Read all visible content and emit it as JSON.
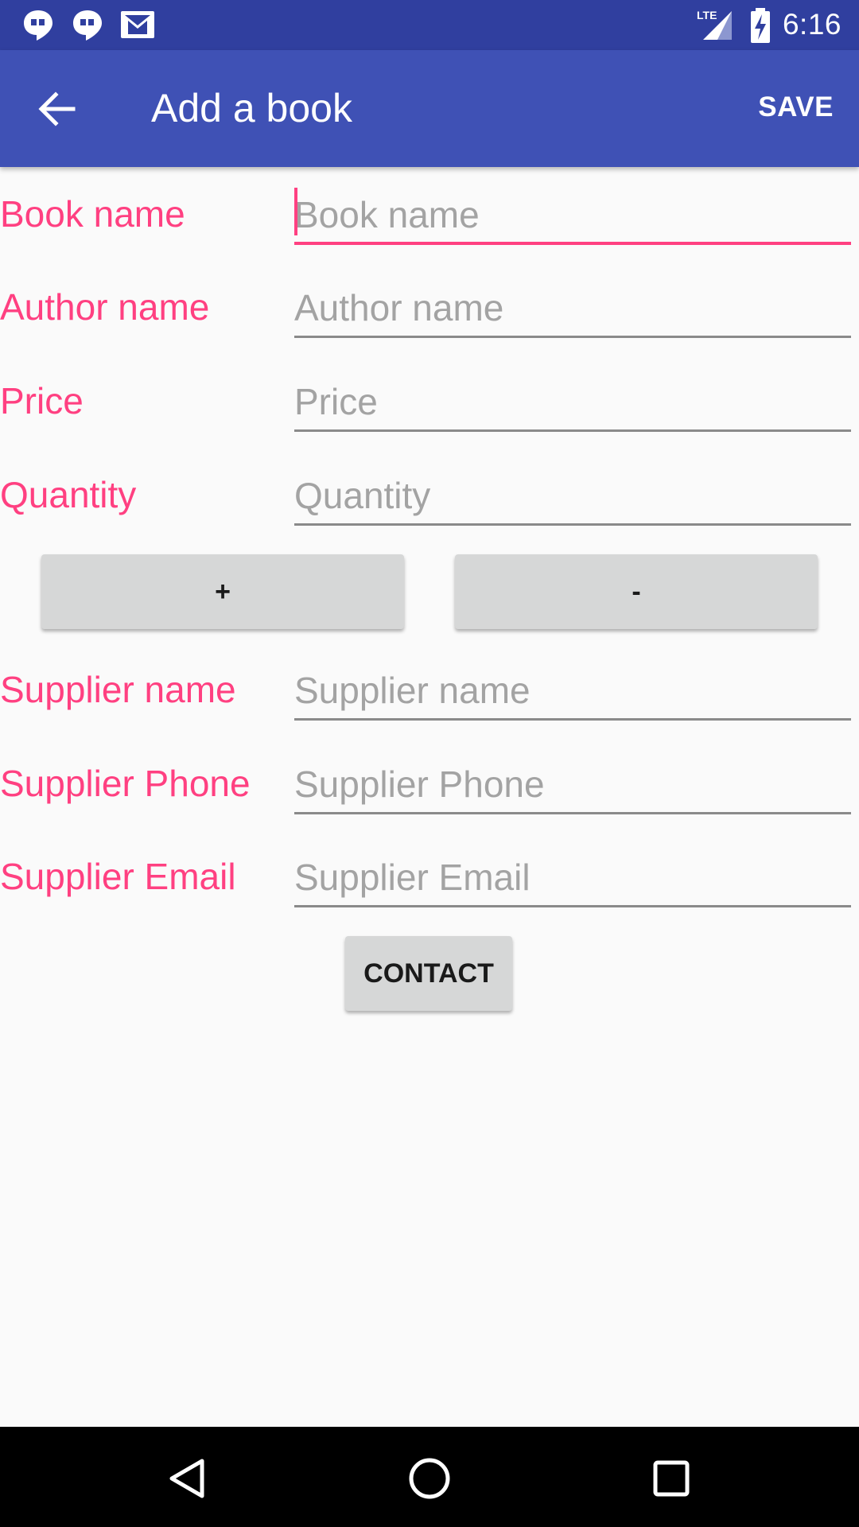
{
  "status_bar": {
    "time": "6:16",
    "network": "LTE",
    "left_icons": [
      "hangouts-icon",
      "hangouts-icon",
      "gmail-icon"
    ],
    "right_icons": [
      "lte-signal-icon",
      "battery-charging-icon"
    ]
  },
  "app_bar": {
    "title": "Add a book",
    "save_label": "SAVE",
    "back_icon": "arrow-back-icon"
  },
  "form": {
    "book_name": {
      "label": "Book name",
      "placeholder": "Book name",
      "value": ""
    },
    "author_name": {
      "label": "Author name",
      "placeholder": "Author name",
      "value": ""
    },
    "price": {
      "label": "Price",
      "placeholder": "Price",
      "value": ""
    },
    "quantity": {
      "label": "Quantity",
      "placeholder": "Quantity",
      "value": ""
    },
    "increment_label": "+",
    "decrement_label": "-",
    "supplier_name": {
      "label": "Supplier name",
      "placeholder": "Supplier name",
      "value": ""
    },
    "supplier_phone": {
      "label": "Supplier Phone",
      "placeholder": "Supplier Phone",
      "value": ""
    },
    "supplier_email": {
      "label": "Supplier Email",
      "placeholder": "Supplier Email",
      "value": ""
    },
    "contact_label": "CONTACT"
  },
  "nav_bar": {
    "icons": [
      "back-triangle-icon",
      "home-circle-icon",
      "recents-square-icon"
    ]
  },
  "colors": {
    "status_bar": "#303f9f",
    "primary": "#3f51b5",
    "accent": "#ff4081",
    "background": "#fafafa",
    "button": "#d6d7d7"
  }
}
